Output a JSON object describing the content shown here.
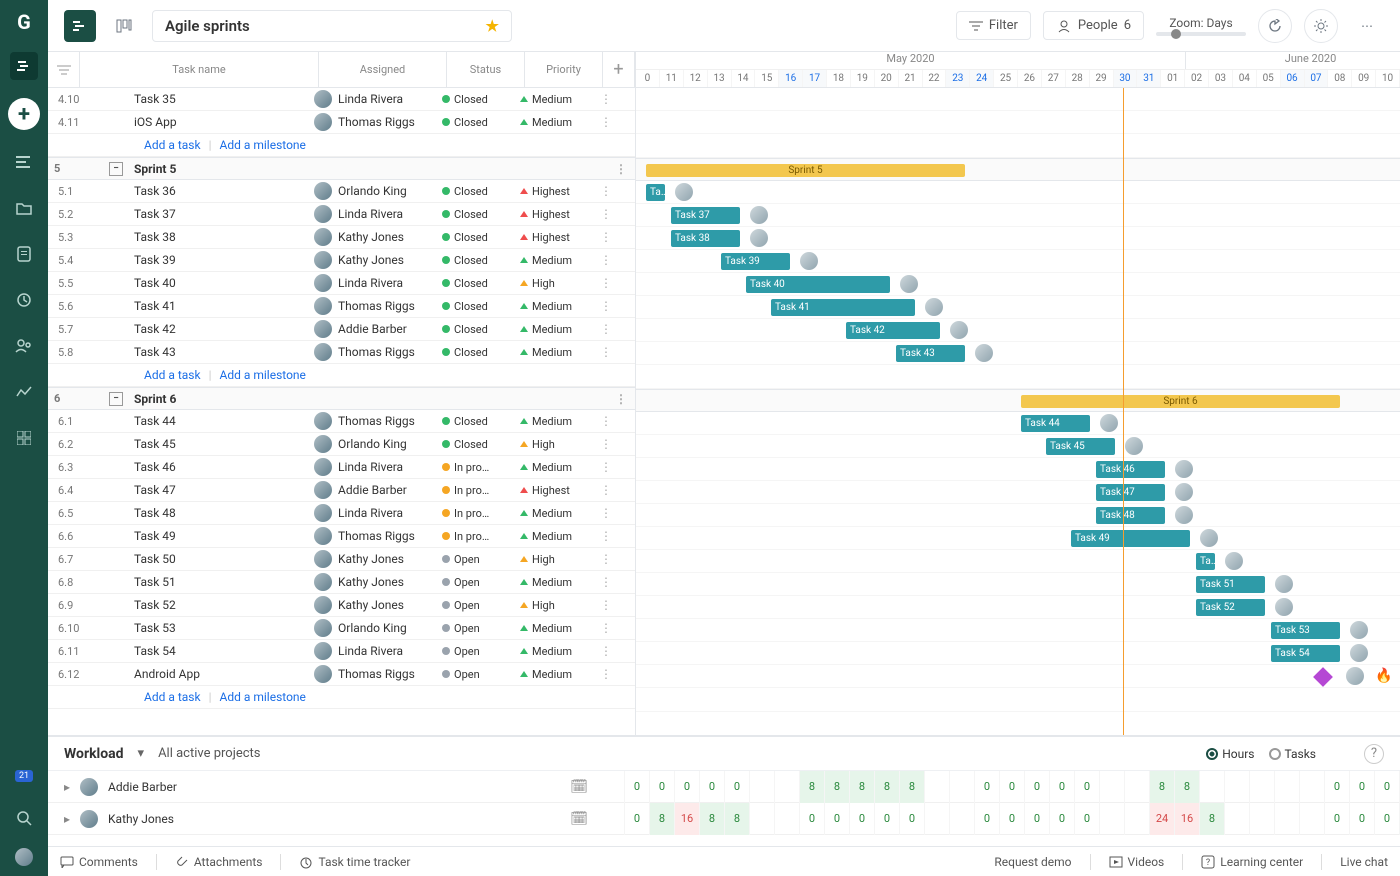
{
  "sidebar": {
    "logo": "G",
    "badge": "21"
  },
  "header": {
    "project_title": "Agile sprints",
    "filter_label": "Filter",
    "people_label": "People",
    "people_count": "6",
    "zoom_label": "Zoom: Days"
  },
  "grid": {
    "columns": {
      "name": "Task name",
      "assigned": "Assigned",
      "status": "Status",
      "priority": "Priority"
    },
    "add_task": "Add a task",
    "add_ms": "Add a milestone"
  },
  "status": {
    "closed": "Closed",
    "inpro": "In pro…",
    "open": "Open"
  },
  "priority": {
    "highest": "Highest",
    "high": "High",
    "medium": "Medium"
  },
  "tasks": [
    {
      "n": "4.10",
      "name": "Task 35",
      "asg": "Linda Rivera",
      "st": "closed",
      "pr": "medium"
    },
    {
      "n": "4.11",
      "name": "iOS App",
      "asg": "Thomas Riggs",
      "st": "closed",
      "pr": "medium"
    },
    {
      "n": "5",
      "name": "Sprint 5",
      "group": true
    },
    {
      "n": "5.1",
      "name": "Task 36",
      "asg": "Orlando King",
      "st": "closed",
      "pr": "highest",
      "bs": 0,
      "bw": 1,
      "bl": "Ta…"
    },
    {
      "n": "5.2",
      "name": "Task 37",
      "asg": "Linda Rivera",
      "st": "closed",
      "pr": "highest",
      "bs": 1,
      "bw": 3,
      "bl": "Task 37"
    },
    {
      "n": "5.3",
      "name": "Task 38",
      "asg": "Kathy Jones",
      "st": "closed",
      "pr": "highest",
      "bs": 1,
      "bw": 3,
      "bl": "Task 38"
    },
    {
      "n": "5.4",
      "name": "Task 39",
      "asg": "Kathy Jones",
      "st": "closed",
      "pr": "medium",
      "bs": 3,
      "bw": 3,
      "bl": "Task 39"
    },
    {
      "n": "5.5",
      "name": "Task 40",
      "asg": "Linda Rivera",
      "st": "closed",
      "pr": "high",
      "bs": 4,
      "bw": 6,
      "bl": "Task 40"
    },
    {
      "n": "5.6",
      "name": "Task 41",
      "asg": "Thomas Riggs",
      "st": "closed",
      "pr": "medium",
      "bs": 5,
      "bw": 6,
      "bl": "Task 41"
    },
    {
      "n": "5.7",
      "name": "Task 42",
      "asg": "Addie Barber",
      "st": "closed",
      "pr": "medium",
      "bs": 8,
      "bw": 4,
      "bl": "Task 42"
    },
    {
      "n": "5.8",
      "name": "Task 43",
      "asg": "Thomas Riggs",
      "st": "closed",
      "pr": "medium",
      "bs": 10,
      "bw": 3,
      "bl": "Task 43"
    },
    {
      "n": "6",
      "name": "Sprint 6",
      "group": true
    },
    {
      "n": "6.1",
      "name": "Task 44",
      "asg": "Thomas Riggs",
      "st": "closed",
      "pr": "medium",
      "bs": 15,
      "bw": 3,
      "bl": "Task 44"
    },
    {
      "n": "6.2",
      "name": "Task 45",
      "asg": "Orlando King",
      "st": "closed",
      "pr": "high",
      "bs": 16,
      "bw": 3,
      "bl": "Task 45"
    },
    {
      "n": "6.3",
      "name": "Task 46",
      "asg": "Linda Rivera",
      "st": "inpro",
      "pr": "medium",
      "bs": 18,
      "bw": 3,
      "bl": "Task 46"
    },
    {
      "n": "6.4",
      "name": "Task 47",
      "asg": "Addie Barber",
      "st": "inpro",
      "pr": "highest",
      "bs": 18,
      "bw": 3,
      "bl": "Task 47"
    },
    {
      "n": "6.5",
      "name": "Task 48",
      "asg": "Linda Rivera",
      "st": "inpro",
      "pr": "medium",
      "bs": 18,
      "bw": 3,
      "bl": "Task 48"
    },
    {
      "n": "6.6",
      "name": "Task 49",
      "asg": "Thomas Riggs",
      "st": "inpro",
      "pr": "medium",
      "bs": 17,
      "bw": 5,
      "bl": "Task 49"
    },
    {
      "n": "6.7",
      "name": "Task 50",
      "asg": "Kathy Jones",
      "st": "open",
      "pr": "high",
      "bs": 22,
      "bw": 1,
      "bl": "Ta…"
    },
    {
      "n": "6.8",
      "name": "Task 51",
      "asg": "Kathy Jones",
      "st": "open",
      "pr": "medium",
      "bs": 22,
      "bw": 3,
      "bl": "Task 51"
    },
    {
      "n": "6.9",
      "name": "Task 52",
      "asg": "Kathy Jones",
      "st": "open",
      "pr": "high",
      "bs": 22,
      "bw": 3,
      "bl": "Task 52"
    },
    {
      "n": "6.10",
      "name": "Task 53",
      "asg": "Orlando King",
      "st": "open",
      "pr": "medium",
      "bs": 25,
      "bw": 3,
      "bl": "Task 53"
    },
    {
      "n": "6.11",
      "name": "Task 54",
      "asg": "Linda Rivera",
      "st": "open",
      "pr": "medium",
      "bs": 25,
      "bw": 3,
      "bl": "Task 54"
    },
    {
      "n": "6.12",
      "name": "Android App",
      "asg": "Thomas Riggs",
      "st": "open",
      "pr": "medium",
      "ms": 27
    }
  ],
  "sprints": [
    {
      "row": 2,
      "start": 0,
      "end": 13,
      "label": "Sprint 5"
    },
    {
      "row": 11,
      "start": 15,
      "end": 28,
      "label": "Sprint 6"
    }
  ],
  "timeline": {
    "months": [
      {
        "label": "May 2020",
        "span": 22
      },
      {
        "label": "June 2020",
        "span": 10
      }
    ],
    "days": [
      {
        "d": "0"
      },
      {
        "d": "11"
      },
      {
        "d": "12"
      },
      {
        "d": "13"
      },
      {
        "d": "14"
      },
      {
        "d": "15"
      },
      {
        "d": "16",
        "wk": true
      },
      {
        "d": "17",
        "wk": true
      },
      {
        "d": "18"
      },
      {
        "d": "19"
      },
      {
        "d": "20"
      },
      {
        "d": "21"
      },
      {
        "d": "22"
      },
      {
        "d": "23",
        "wk": true
      },
      {
        "d": "24",
        "wk": true
      },
      {
        "d": "25"
      },
      {
        "d": "26"
      },
      {
        "d": "27"
      },
      {
        "d": "28"
      },
      {
        "d": "29"
      },
      {
        "d": "30",
        "wk": true
      },
      {
        "d": "31",
        "wk": true
      },
      {
        "d": "01"
      },
      {
        "d": "02"
      },
      {
        "d": "03"
      },
      {
        "d": "04"
      },
      {
        "d": "05"
      },
      {
        "d": "06",
        "wk": true
      },
      {
        "d": "07",
        "wk": true
      },
      {
        "d": "08"
      },
      {
        "d": "09"
      },
      {
        "d": "10"
      }
    ],
    "today_col": 19
  },
  "workload": {
    "title": "Workload",
    "filter": "All active projects",
    "hours": "Hours",
    "tasks": "Tasks",
    "rows": [
      {
        "name": "Addie Barber",
        "cells": [
          "",
          "0",
          "0",
          "0",
          "0",
          "0",
          "",
          "",
          "8",
          "8",
          "8",
          "8",
          "8",
          "",
          "",
          "0",
          "0",
          "0",
          "0",
          "0",
          "",
          "",
          "8",
          "8",
          "",
          "",
          "",
          "",
          "",
          "0",
          "0",
          "0"
        ]
      },
      {
        "name": "Kathy Jones",
        "cells": [
          "",
          "0",
          "8",
          "16",
          "8",
          "8",
          "",
          "",
          "0",
          "0",
          "0",
          "0",
          "0",
          "",
          "",
          "0",
          "0",
          "0",
          "0",
          "0",
          "",
          "",
          "24",
          "16",
          "8",
          "",
          "",
          "",
          "",
          "0",
          "0",
          "0"
        ]
      }
    ]
  },
  "footer": {
    "comments": "Comments",
    "attach": "Attachments",
    "tracker": "Task time tracker",
    "demo": "Request demo",
    "videos": "Videos",
    "learn": "Learning center",
    "chat": "Live chat"
  }
}
